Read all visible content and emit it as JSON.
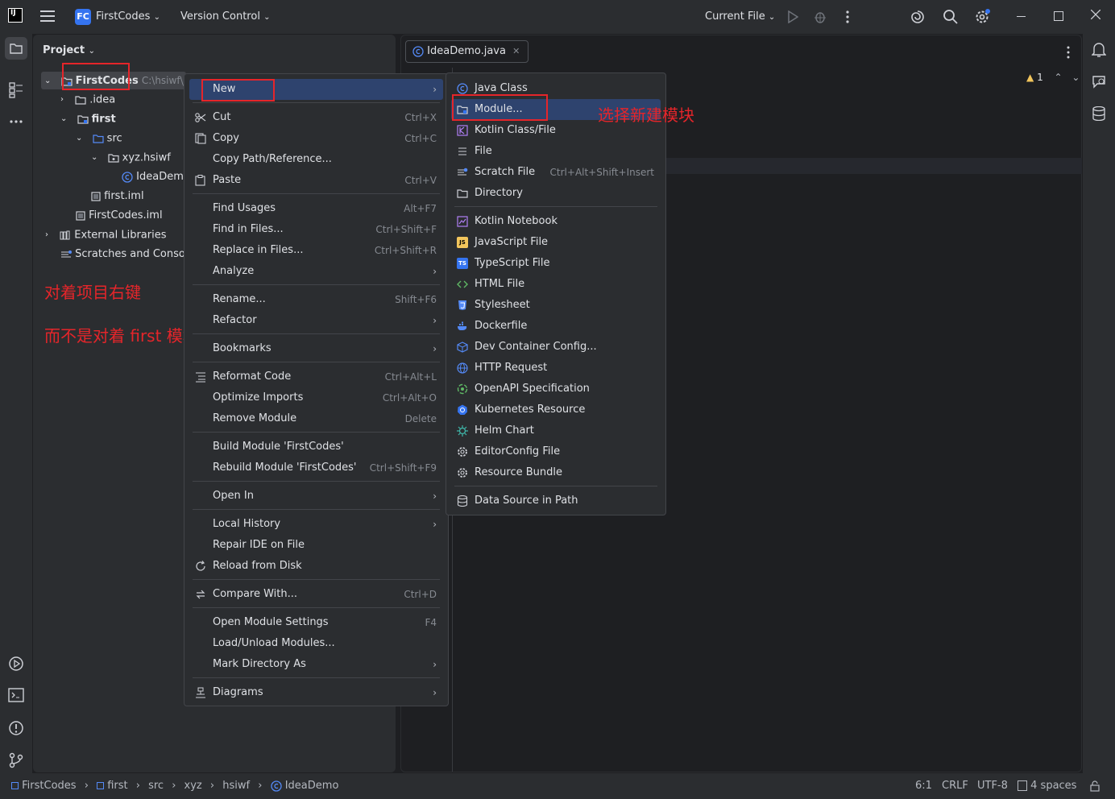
{
  "titlebar": {
    "project_badge": "FC",
    "project_name": "FirstCodes",
    "vcs_label": "Version Control",
    "run_config": "Current File"
  },
  "project_panel": {
    "title": "Project",
    "tree": {
      "root_name": "FirstCodes",
      "root_path": "C:\\hsiwf\\Ja",
      "idea": ".idea",
      "first": "first",
      "src": "src",
      "pkg": "xyz.hsiwf",
      "ideademo": "IdeaDemo",
      "first_iml": "first.iml",
      "firstcodes_iml": "FirstCodes.iml",
      "external_libs": "External Libraries",
      "scratches": "Scratches and Console"
    }
  },
  "annotations": {
    "right_click_project": "对着项目右键",
    "not_module": "而不是对着 first 模块右键",
    "choose_new_module": "选择新建模块"
  },
  "editor": {
    "tab_label": "IdeaDemo.java",
    "warning_count": "1"
  },
  "context_menu": {
    "items": [
      {
        "label": "New",
        "shortcut": ""
      },
      {
        "label": "Cut",
        "shortcut": "Ctrl+X"
      },
      {
        "label": "Copy",
        "shortcut": "Ctrl+C"
      },
      {
        "label": "Copy Path/Reference...",
        "shortcut": ""
      },
      {
        "label": "Paste",
        "shortcut": "Ctrl+V"
      },
      {
        "label": "Find Usages",
        "shortcut": "Alt+F7"
      },
      {
        "label": "Find in Files...",
        "shortcut": "Ctrl+Shift+F"
      },
      {
        "label": "Replace in Files...",
        "shortcut": "Ctrl+Shift+R"
      },
      {
        "label": "Analyze",
        "shortcut": ""
      },
      {
        "label": "Rename...",
        "shortcut": "Shift+F6"
      },
      {
        "label": "Refactor",
        "shortcut": ""
      },
      {
        "label": "Bookmarks",
        "shortcut": ""
      },
      {
        "label": "Reformat Code",
        "shortcut": "Ctrl+Alt+L"
      },
      {
        "label": "Optimize Imports",
        "shortcut": "Ctrl+Alt+O"
      },
      {
        "label": "Remove Module",
        "shortcut": "Delete"
      },
      {
        "label": "Build Module 'FirstCodes'",
        "shortcut": ""
      },
      {
        "label": "Rebuild Module 'FirstCodes'",
        "shortcut": "Ctrl+Shift+F9"
      },
      {
        "label": "Open In",
        "shortcut": ""
      },
      {
        "label": "Local History",
        "shortcut": ""
      },
      {
        "label": "Repair IDE on File",
        "shortcut": ""
      },
      {
        "label": "Reload from Disk",
        "shortcut": ""
      },
      {
        "label": "Compare With...",
        "shortcut": "Ctrl+D"
      },
      {
        "label": "Open Module Settings",
        "shortcut": "F4"
      },
      {
        "label": "Load/Unload Modules...",
        "shortcut": ""
      },
      {
        "label": "Mark Directory As",
        "shortcut": ""
      },
      {
        "label": "Diagrams",
        "shortcut": ""
      }
    ]
  },
  "new_submenu": {
    "items": [
      {
        "label": "Java Class",
        "shortcut": ""
      },
      {
        "label": "Module...",
        "shortcut": ""
      },
      {
        "label": "Kotlin Class/File",
        "shortcut": ""
      },
      {
        "label": "File",
        "shortcut": ""
      },
      {
        "label": "Scratch File",
        "shortcut": "Ctrl+Alt+Shift+Insert"
      },
      {
        "label": "Directory",
        "shortcut": ""
      },
      {
        "label": "Kotlin Notebook",
        "shortcut": ""
      },
      {
        "label": "JavaScript File",
        "shortcut": ""
      },
      {
        "label": "TypeScript File",
        "shortcut": ""
      },
      {
        "label": "HTML File",
        "shortcut": ""
      },
      {
        "label": "Stylesheet",
        "shortcut": ""
      },
      {
        "label": "Dockerfile",
        "shortcut": ""
      },
      {
        "label": "Dev Container Config...",
        "shortcut": ""
      },
      {
        "label": "HTTP Request",
        "shortcut": ""
      },
      {
        "label": "OpenAPI Specification",
        "shortcut": ""
      },
      {
        "label": "Kubernetes Resource",
        "shortcut": ""
      },
      {
        "label": "Helm Chart",
        "shortcut": ""
      },
      {
        "label": "EditorConfig File",
        "shortcut": ""
      },
      {
        "label": "Resource Bundle",
        "shortcut": ""
      },
      {
        "label": "Data Source in Path",
        "shortcut": ""
      }
    ]
  },
  "statusbar": {
    "breadcrumb": [
      "FirstCodes",
      "first",
      "src",
      "xyz",
      "hsiwf",
      "IdeaDemo"
    ],
    "position": "6:1",
    "line_ending": "CRLF",
    "encoding": "UTF-8",
    "indent": "4 spaces"
  },
  "colors": {
    "accent": "#3574f0",
    "selection": "#2e436e",
    "annotation_red": "#e5252a"
  }
}
